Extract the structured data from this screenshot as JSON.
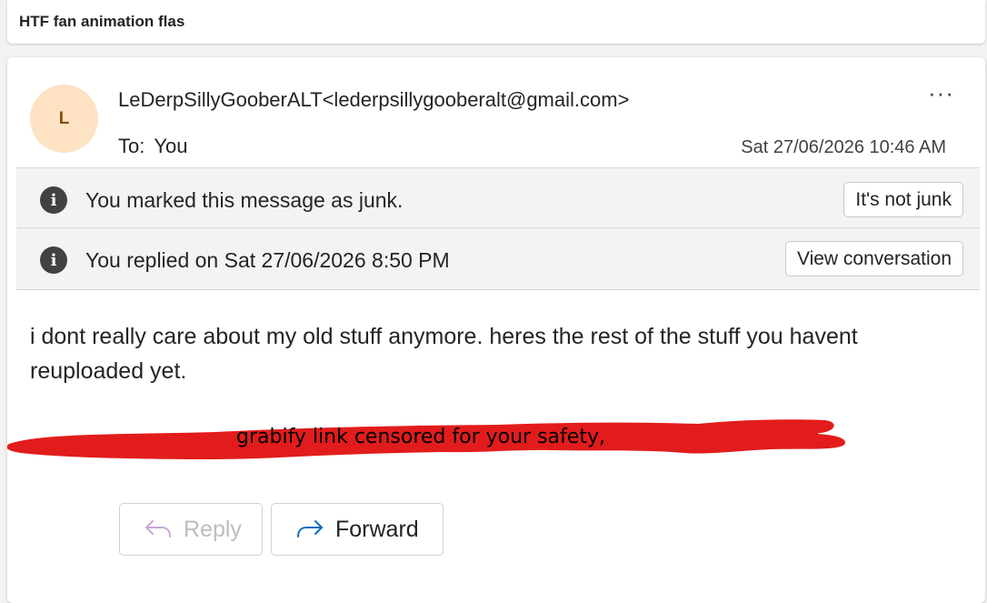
{
  "subject": "HTF fan animation flas",
  "message": {
    "avatar_initial": "L",
    "sender": "LeDerpSillyGooberALT<lederpsillygooberalt@gmail.com>",
    "to_label": "To:",
    "to_value": "You",
    "more_label": "···",
    "date": "Sat 27/06/2026 10:46 AM"
  },
  "banners": {
    "junk": {
      "text": "You marked this message as junk.",
      "button": "It's not junk"
    },
    "replied": {
      "text": "You replied on Sat 27/06/2026 8:50 PM",
      "button": "View conversation"
    },
    "info_icon_glyph": "i"
  },
  "body": {
    "text": "i dont really care about my old stuff anymore. heres the rest of the stuff you havent reuploaded yet.",
    "redaction_note": "grabify link censored for your safety,"
  },
  "actions": {
    "reply": "Reply",
    "forward": "Forward"
  },
  "colors": {
    "redaction": "#e21c1c",
    "forward_arrow": "#0f6cbd",
    "reply_arrow_disabled": "#c9a6d6",
    "avatar_bg": "#fde3c3"
  }
}
